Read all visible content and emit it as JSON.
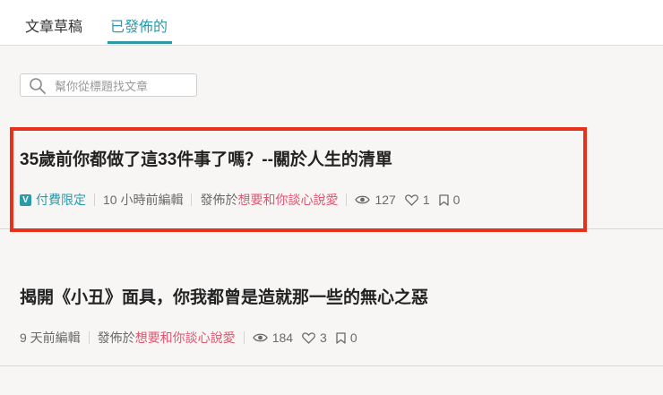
{
  "tabs": [
    {
      "label": "文章草稿"
    },
    {
      "label": "已發佈的"
    }
  ],
  "search": {
    "placeholder": "幫你從標題找文章"
  },
  "articles": [
    {
      "title": "35歲前你都做了這33件事了嗎？--關於人生的清單",
      "badge": "V",
      "paid_label": "付費限定",
      "edited": "10 小時前編輯",
      "published_prefix": "發佈於",
      "publication": "想要和你談心說愛",
      "views": "127",
      "likes": "1",
      "bookmarks": "0"
    },
    {
      "title": "揭開《小丑》面具，你我都曾是造就那一些的無心之惡",
      "edited": "9 天前編輯",
      "published_prefix": "發佈於",
      "publication": "想要和你談心說愛",
      "views": "184",
      "likes": "3",
      "bookmarks": "0"
    }
  ],
  "colors": {
    "accent": "#2e9aa8",
    "publication": "#e0566f",
    "highlight": "#e8301c"
  }
}
